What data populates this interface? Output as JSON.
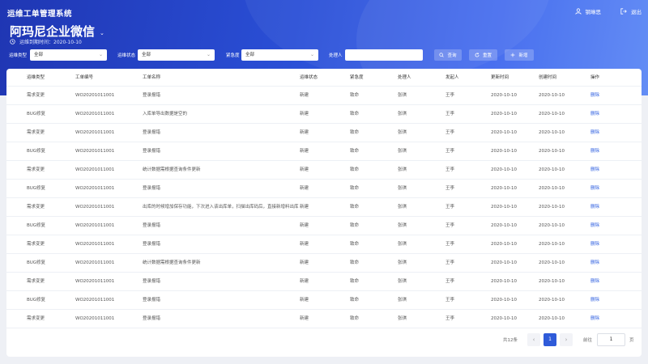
{
  "header": {
    "system_title": "运维工单管理系统",
    "user_name": "钢琳思",
    "logout_label": "退出",
    "company_name": "阿玛尼企业微信",
    "expire_text": "运维到期时间：2020-10-10"
  },
  "filters": {
    "ops_type_label": "运维类型",
    "ops_type_value": "全部",
    "ops_status_label": "运维状态",
    "ops_status_value": "全部",
    "urgency_label": "紧急度",
    "urgency_value": "全部",
    "handler_label": "处理人",
    "handler_value": "",
    "search_label": "查询",
    "reset_label": "重置",
    "add_label": "新增"
  },
  "table": {
    "columns": [
      "运维类型",
      "工单编号",
      "工单名称",
      "运维状态",
      "紧急度",
      "处理人",
      "发起人",
      "更新时间",
      "创建时间",
      "操作"
    ],
    "rows": [
      [
        "需求变更",
        "WO20201011001",
        "登录报错",
        "新建",
        "致命",
        "张琪",
        "王李",
        "2020-10-10",
        "2020-10-10",
        "删除"
      ],
      [
        "BUG修复",
        "WO20201011001",
        "入库单导出数据是空的",
        "新建",
        "致命",
        "张琪",
        "王李",
        "2020-10-10",
        "2020-10-10",
        "删除"
      ],
      [
        "需求变更",
        "WO20201011001",
        "登录报错",
        "新建",
        "致命",
        "张琪",
        "王李",
        "2020-10-10",
        "2020-10-10",
        "删除"
      ],
      [
        "BUG修复",
        "WO20201011001",
        "登录报错",
        "新建",
        "致命",
        "张琪",
        "王李",
        "2020-10-10",
        "2020-10-10",
        "删除"
      ],
      [
        "需求变更",
        "WO20201011001",
        "统计数据需根据查询条件更新",
        "新建",
        "致命",
        "张琪",
        "王李",
        "2020-10-10",
        "2020-10-10",
        "删除"
      ],
      [
        "BUG修复",
        "WO20201011001",
        "登录报错",
        "新建",
        "致命",
        "张琪",
        "王李",
        "2020-10-10",
        "2020-10-10",
        "删除"
      ],
      [
        "需求变更",
        "WO20201011001",
        "出库的时候增加保存功能，下次进入该出库单，扫描出库码后，直接新增料出库",
        "新建",
        "致命",
        "张琪",
        "王李",
        "2020-10-10",
        "2020-10-10",
        "删除"
      ],
      [
        "BUG修复",
        "WO20201011001",
        "登录报错",
        "新建",
        "致命",
        "张琪",
        "王李",
        "2020-10-10",
        "2020-10-10",
        "删除"
      ],
      [
        "需求变更",
        "WO20201011001",
        "登录报错",
        "新建",
        "致命",
        "张琪",
        "王李",
        "2020-10-10",
        "2020-10-10",
        "删除"
      ],
      [
        "BUG修复",
        "WO20201011001",
        "统计数据需根据查询条件更新",
        "新建",
        "致命",
        "张琪",
        "王李",
        "2020-10-10",
        "2020-10-10",
        "删除"
      ],
      [
        "需求变更",
        "WO20201011001",
        "登录报错",
        "新建",
        "致命",
        "张琪",
        "王李",
        "2020-10-10",
        "2020-10-10",
        "删除"
      ],
      [
        "BUG修复",
        "WO20201011001",
        "登录报错",
        "新建",
        "致命",
        "张琪",
        "王李",
        "2020-10-10",
        "2020-10-10",
        "删除"
      ],
      [
        "需求变更",
        "WO20201011001",
        "登录报错",
        "新建",
        "致命",
        "张琪",
        "王李",
        "2020-10-10",
        "2020-10-10",
        "删除"
      ]
    ]
  },
  "pagination": {
    "total_text": "共12条",
    "prev_icon": "‹",
    "current_page": "1",
    "next_icon": "›",
    "goto_label": "前往",
    "goto_value": "1",
    "page_suffix": "页"
  },
  "colors": {
    "accent": "#2f5bd9",
    "link": "#3060e0",
    "header_start": "#1f36b3",
    "header_end": "#5a86f5"
  },
  "icons": {
    "user": "user-icon",
    "logout": "logout-icon",
    "clock": "clock-icon",
    "search": "search-icon",
    "reset": "refresh-icon",
    "add": "plus-icon"
  }
}
